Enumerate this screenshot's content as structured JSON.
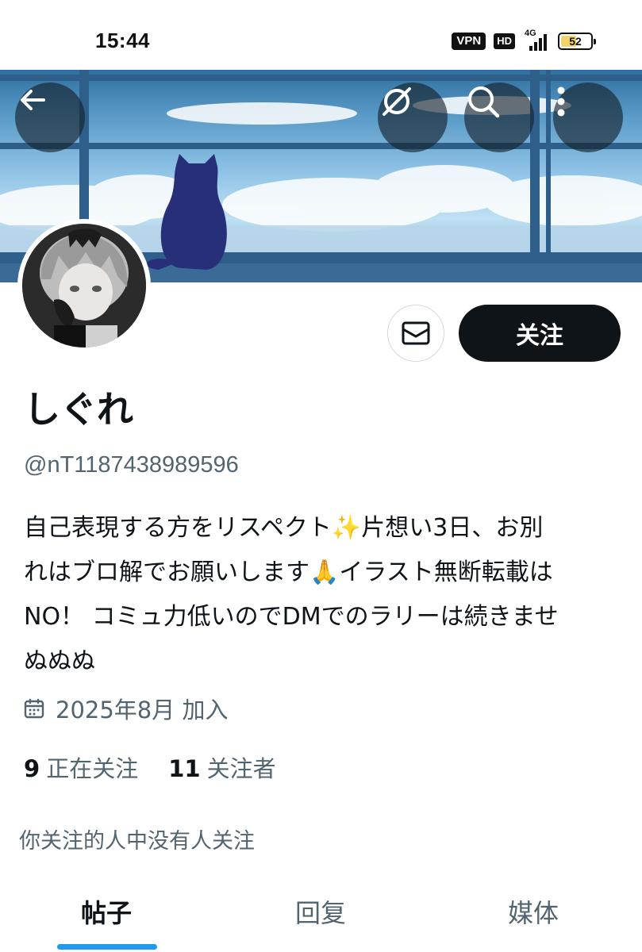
{
  "status_bar": {
    "time": "15:44",
    "vpn": "VPN",
    "hd": "HD",
    "network": "4G",
    "battery": "52",
    "battery_level": 0.52
  },
  "banner": {
    "icons": [
      "back-arrow-icon",
      "grok-icon",
      "search-icon",
      "more-vertical-icon"
    ]
  },
  "profile": {
    "display_name": "しぐれ",
    "handle": "@nT1187438989596",
    "bio_lines": [
      "自己表現する方をリスペクト✨片想い3日、お別",
      "れはブロ解でお願いします🙏イラスト無断転載は",
      "NO！ コミュ力低いのでDMでのラリーは続きませ",
      "ぬぬぬ"
    ],
    "joined": "2025年8月 加入",
    "following_count": "9",
    "following_label": "正在关注",
    "followers_count": "11",
    "followers_label": "关注者",
    "followed_by": "你关注的人中没有人关注"
  },
  "actions": {
    "follow_label": "关注",
    "message_icon": "mail-icon"
  },
  "tabs": [
    {
      "label": "帖子",
      "active": true
    },
    {
      "label": "回复",
      "active": false
    },
    {
      "label": "媒体",
      "active": false
    }
  ],
  "colors": {
    "text_primary": "#0f1419",
    "text_secondary": "#536471",
    "accent": "#1d9bf0",
    "follow_bg": "#0f1419"
  }
}
